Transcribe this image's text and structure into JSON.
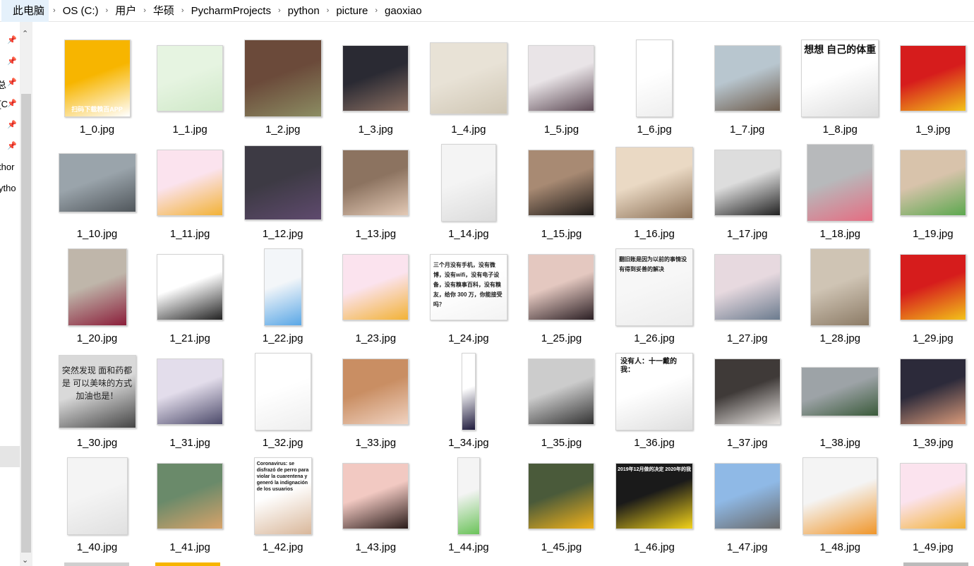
{
  "breadcrumb": {
    "items": [
      "此电脑",
      "OS (C:)",
      "用户",
      "华硕",
      "PycharmProjects",
      "python",
      "picture",
      "gaoxiao"
    ],
    "separator": "›"
  },
  "nav_pane": {
    "labels": [
      "总",
      "[C",
      "thor",
      "ytho"
    ]
  },
  "files": [
    {
      "name": "1_0.jpg",
      "colors": [
        "#f7b500",
        "#ffffff"
      ],
      "text": "扫码下载糗百APP",
      "w": 92,
      "h": 108
    },
    {
      "name": "1_1.jpg",
      "colors": [
        "#e6f4e1",
        "#cfe8c8"
      ],
      "w": 92,
      "h": 92
    },
    {
      "name": "1_2.jpg",
      "colors": [
        "#6b4a3a",
        "#8c8d63"
      ],
      "w": 108,
      "h": 108
    },
    {
      "name": "1_3.jpg",
      "colors": [
        "#2a2a33",
        "#8a6f62"
      ],
      "w": 92,
      "h": 92
    },
    {
      "name": "1_4.jpg",
      "colors": [
        "#e8e2d6",
        "#cfc6b4"
      ],
      "w": 108,
      "h": 100
    },
    {
      "name": "1_5.jpg",
      "colors": [
        "#e9e4e7",
        "#5d4a55"
      ],
      "w": 92,
      "h": 92
    },
    {
      "name": "1_6.jpg",
      "colors": [
        "#ffffff",
        "#eeeeee"
      ],
      "w": 50,
      "h": 108
    },
    {
      "name": "1_7.jpg",
      "colors": [
        "#b8c6cf",
        "#6d5b4b"
      ],
      "w": 92,
      "h": 92
    },
    {
      "name": "1_8.jpg",
      "colors": [
        "#ffffff",
        "#dddddd"
      ],
      "text": "想想 自己的体重",
      "w": 108,
      "h": 108
    },
    {
      "name": "1_9.jpg",
      "colors": [
        "#d61c1c",
        "#f2c21a"
      ],
      "w": 92,
      "h": 92
    },
    {
      "name": "1_10.jpg",
      "colors": [
        "#9aa4ab",
        "#50565b"
      ],
      "w": 108,
      "h": 82
    },
    {
      "name": "1_11.jpg",
      "colors": [
        "#fbe3ee",
        "#f2b236"
      ],
      "w": 92,
      "h": 92
    },
    {
      "name": "1_12.jpg",
      "colors": [
        "#3d3a44",
        "#5f4a6e"
      ],
      "w": 108,
      "h": 104
    },
    {
      "name": "1_13.jpg",
      "colors": [
        "#8c7360",
        "#e3c9b5"
      ],
      "w": 92,
      "h": 92
    },
    {
      "name": "1_14.jpg",
      "colors": [
        "#f4f4f4",
        "#dcdcdc"
      ],
      "w": 76,
      "h": 108
    },
    {
      "name": "1_15.jpg",
      "colors": [
        "#a88a73",
        "#1f1b19"
      ],
      "w": 92,
      "h": 92
    },
    {
      "name": "1_16.jpg",
      "colors": [
        "#ead9c4",
        "#8a6f55"
      ],
      "w": 108,
      "h": 100
    },
    {
      "name": "1_17.jpg",
      "colors": [
        "#dddddd",
        "#222222"
      ],
      "w": 92,
      "h": 92
    },
    {
      "name": "1_18.jpg",
      "colors": [
        "#b7b9bb",
        "#e56d82"
      ],
      "w": 92,
      "h": 108
    },
    {
      "name": "1_19.jpg",
      "colors": [
        "#d8c3ab",
        "#5ca84f"
      ],
      "w": 92,
      "h": 92
    },
    {
      "name": "1_20.jpg",
      "colors": [
        "#bfb6aa",
        "#8b1e3a"
      ],
      "w": 82,
      "h": 108
    },
    {
      "name": "1_21.jpg",
      "colors": [
        "#ffffff",
        "#222222"
      ],
      "w": 92,
      "h": 92
    },
    {
      "name": "1_22.jpg",
      "colors": [
        "#f3f6f9",
        "#5aa7e6"
      ],
      "w": 52,
      "h": 108
    },
    {
      "name": "1_23.jpg",
      "colors": [
        "#fbe3ee",
        "#f2b236"
      ],
      "w": 92,
      "h": 92
    },
    {
      "name": "1_24.jpg",
      "colors": [
        "#ffffff",
        "#f3f3f3"
      ],
      "text": "三个月没有手机，没有微博，没有wifi，没有电子设备，没有糗事百科，没有糗友，给你 300 万，你能接受吗？",
      "w": 108,
      "h": 92
    },
    {
      "name": "1_25.jpg",
      "colors": [
        "#e4c8c0",
        "#2b1f24"
      ],
      "w": 92,
      "h": 92
    },
    {
      "name": "1_26.jpg",
      "colors": [
        "#f7f7f7",
        "#ececec"
      ],
      "text": "翻旧账是因为以前的事情没有得到妥善的解决",
      "w": 108,
      "h": 108
    },
    {
      "name": "1_27.jpg",
      "colors": [
        "#e7d9df",
        "#6b7b8e"
      ],
      "w": 92,
      "h": 92
    },
    {
      "name": "1_28.jpg",
      "colors": [
        "#cfc4b4",
        "#8c7b66"
      ],
      "w": 82,
      "h": 108
    },
    {
      "name": "1_29.jpg",
      "colors": [
        "#d61c1c",
        "#f2c21a"
      ],
      "w": 92,
      "h": 92
    },
    {
      "name": "1_30.jpg",
      "colors": [
        "#d9d9d9",
        "#444444"
      ],
      "text": "突然发现 面和药都是 可以美味的方式 加油也是！",
      "w": 108,
      "h": 102
    },
    {
      "name": "1_31.jpg",
      "colors": [
        "#e3ddeb",
        "#4c4a6a"
      ],
      "w": 92,
      "h": 92
    },
    {
      "name": "1_32.jpg",
      "colors": [
        "#ffffff",
        "#eeeeee"
      ],
      "w": 78,
      "h": 108
    },
    {
      "name": "1_33.jpg",
      "colors": [
        "#c98e63",
        "#f0d2c0"
      ],
      "w": 92,
      "h": 92
    },
    {
      "name": "1_34.jpg",
      "colors": [
        "#ffffff",
        "#1e1a3c"
      ],
      "w": 18,
      "h": 108
    },
    {
      "name": "1_35.jpg",
      "colors": [
        "#cccccc",
        "#333333"
      ],
      "w": 92,
      "h": 92
    },
    {
      "name": "1_36.jpg",
      "colors": [
        "#ffffff",
        "#dedede"
      ],
      "text": "没有人：十一戴的我：",
      "w": 108,
      "h": 108
    },
    {
      "name": "1_37.jpg",
      "colors": [
        "#3f3a38",
        "#e8e4e1"
      ],
      "w": 92,
      "h": 92
    },
    {
      "name": "1_38.jpg",
      "colors": [
        "#9da3a7",
        "#3a5a3a"
      ],
      "w": 108,
      "h": 68
    },
    {
      "name": "1_39.jpg",
      "colors": [
        "#2c2a3a",
        "#d99a7a"
      ],
      "w": 92,
      "h": 92
    },
    {
      "name": "1_40.jpg",
      "colors": [
        "#f4f4f4",
        "#e0e0e0"
      ],
      "w": 84,
      "h": 108
    },
    {
      "name": "1_41.jpg",
      "colors": [
        "#6a8a6a",
        "#d8a36a"
      ],
      "w": 92,
      "h": 92
    },
    {
      "name": "1_42.jpg",
      "colors": [
        "#ffffff",
        "#d9b79a"
      ],
      "text": "Coronavirus: se disfrazó de perro para violar la cuarentena y generó la indignación de los usuarios",
      "w": 80,
      "h": 108
    },
    {
      "name": "1_43.jpg",
      "colors": [
        "#f2c9c2",
        "#2a1c1a"
      ],
      "w": 92,
      "h": 92
    },
    {
      "name": "1_44.jpg",
      "colors": [
        "#f4f4f4",
        "#6bc35a"
      ],
      "w": 30,
      "h": 108
    },
    {
      "name": "1_45.jpg",
      "colors": [
        "#4a5a3a",
        "#f2b21a"
      ],
      "w": 92,
      "h": 92
    },
    {
      "name": "1_46.jpg",
      "colors": [
        "#1a1a1a",
        "#f2d21a"
      ],
      "text": "2019年12月做的决定   2020年的我",
      "w": 108,
      "h": 92
    },
    {
      "name": "1_47.jpg",
      "colors": [
        "#8fb9e6",
        "#6a6a6a"
      ],
      "w": 92,
      "h": 92
    },
    {
      "name": "1_48.jpg",
      "colors": [
        "#f4f4f4",
        "#f0962a"
      ],
      "w": 104,
      "h": 108
    },
    {
      "name": "1_49.jpg",
      "colors": [
        "#fbe3ee",
        "#f2b236"
      ],
      "w": 92,
      "h": 92
    }
  ]
}
